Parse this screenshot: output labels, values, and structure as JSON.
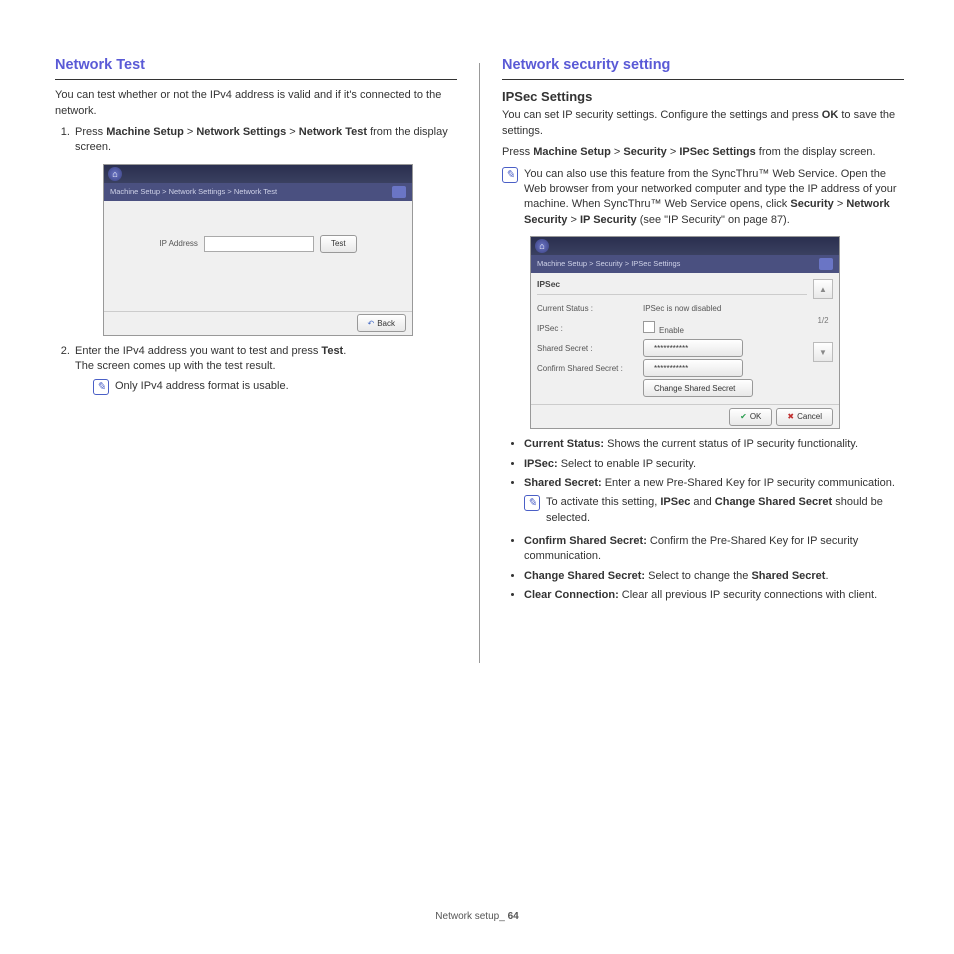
{
  "left": {
    "heading": "Network Test",
    "intro": "You can test whether or not the IPv4 address is valid and if it's connected to the network.",
    "step1_prefix": "Press ",
    "step1_seg1": "Machine Setup",
    "step1_sep": " > ",
    "step1_seg2": "Network Settings",
    "step1_seg3": "Network Test",
    "step1_suffix": " from the display screen.",
    "shot": {
      "breadcrumb": "Machine Setup > Network Settings > Network Test",
      "ip_label": "IP Address",
      "test_btn": "Test",
      "back_btn": "Back"
    },
    "step2_line1": "Enter the IPv4 address you want to test and press ",
    "step2_bold": "Test",
    "step2_line1_end": ".",
    "step2_line2": "The screen comes up with the test result.",
    "note1": "Only IPv4 address format is usable."
  },
  "right": {
    "heading": "Network security setting",
    "sub": "IPSec Settings",
    "intro_a": "You can set IP security settings. Configure the settings and press ",
    "intro_bold": "OK",
    "intro_b": " to save the settings.",
    "press_a": "Press ",
    "press_seg1": "Machine Setup",
    "press_sep": " > ",
    "press_seg2": "Security",
    "press_seg3": "IPSec Settings",
    "press_b": " from the display screen.",
    "note_top_a": "You can also use this feature from the SyncThru™ Web Service. Open the Web browser from your networked computer and type the IP address of your machine. When SyncThru™ Web Service opens, click ",
    "note_top_seg1": "Security",
    "note_top_sep": " > ",
    "note_top_seg2": "Network Security",
    "note_top_seg3": "IP Security",
    "note_top_b": " (see \"IP Security\" on page 87).",
    "shot": {
      "breadcrumb": "Machine Setup > Security > IPSec Settings",
      "group": "IPSec",
      "row1_label": "Current Status :",
      "row1_value": "IPSec is now disabled",
      "row2_label": "IPSec :",
      "row2_value": "Enable",
      "row3_label": "Shared Secret :",
      "row3_value": "***********",
      "row4_label": "Confirm Shared Secret :",
      "row4_value": "***********",
      "change_btn": "Change Shared Secret",
      "page": "1/2",
      "ok": "OK",
      "cancel": "Cancel"
    },
    "bullets": {
      "b1_t": "Current Status:",
      "b1_d": "  Shows the current status of IP security functionality.",
      "b2_t": "IPSec:",
      "b2_d": "  Select to enable IP security.",
      "b3_t": "Shared Secret:",
      "b3_d": "  Enter a new Pre-Shared Key for IP security communication.",
      "b4_t": "Confirm Shared Secret:",
      "b4_d": "  Confirm the Pre-Shared Key for IP security communication.",
      "b5_t": "Change Shared Secret:",
      "b5_d_a": "  Select to change the ",
      "b5_d_bold": "Shared Secret",
      "b5_d_b": ".",
      "b6_t": "Clear Connection:",
      "b6_d": "  Clear all previous IP security connections with client."
    },
    "note_mid_a": " To activate this setting, ",
    "note_mid_seg1": "IPSec",
    "note_mid_and": " and ",
    "note_mid_seg2": "Change Shared Secret",
    "note_mid_b": " should be selected."
  },
  "footer": {
    "label": "Network setup",
    "sep": "_ ",
    "page": "64"
  }
}
